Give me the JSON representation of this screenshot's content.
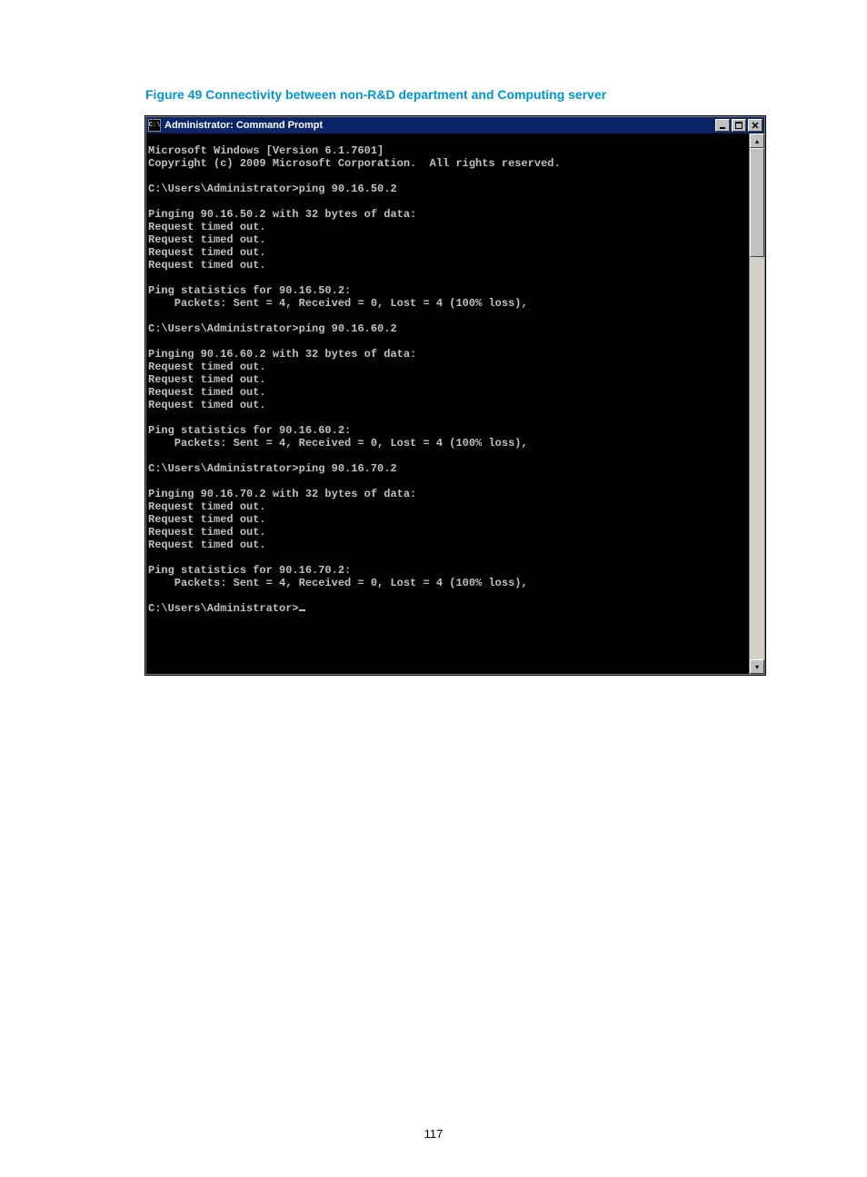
{
  "caption": "Figure 49 Connectivity between non-R&D department and Computing server",
  "window": {
    "title": "Administrator: Command Prompt",
    "sys_icon_text": "C:\\"
  },
  "console": {
    "lines": [
      "Microsoft Windows [Version 6.1.7601]",
      "Copyright (c) 2009 Microsoft Corporation.  All rights reserved.",
      "",
      "C:\\Users\\Administrator>ping 90.16.50.2",
      "",
      "Pinging 90.16.50.2 with 32 bytes of data:",
      "Request timed out.",
      "Request timed out.",
      "Request timed out.",
      "Request timed out.",
      "",
      "Ping statistics for 90.16.50.2:",
      "    Packets: Sent = 4, Received = 0, Lost = 4 (100% loss),",
      "",
      "C:\\Users\\Administrator>ping 90.16.60.2",
      "",
      "Pinging 90.16.60.2 with 32 bytes of data:",
      "Request timed out.",
      "Request timed out.",
      "Request timed out.",
      "Request timed out.",
      "",
      "Ping statistics for 90.16.60.2:",
      "    Packets: Sent = 4, Received = 0, Lost = 4 (100% loss),",
      "",
      "C:\\Users\\Administrator>ping 90.16.70.2",
      "",
      "Pinging 90.16.70.2 with 32 bytes of data:",
      "Request timed out.",
      "Request timed out.",
      "Request timed out.",
      "Request timed out.",
      "",
      "Ping statistics for 90.16.70.2:",
      "    Packets: Sent = 4, Received = 0, Lost = 4 (100% loss),",
      "",
      "C:\\Users\\Administrator>_"
    ]
  },
  "page_number": "117"
}
